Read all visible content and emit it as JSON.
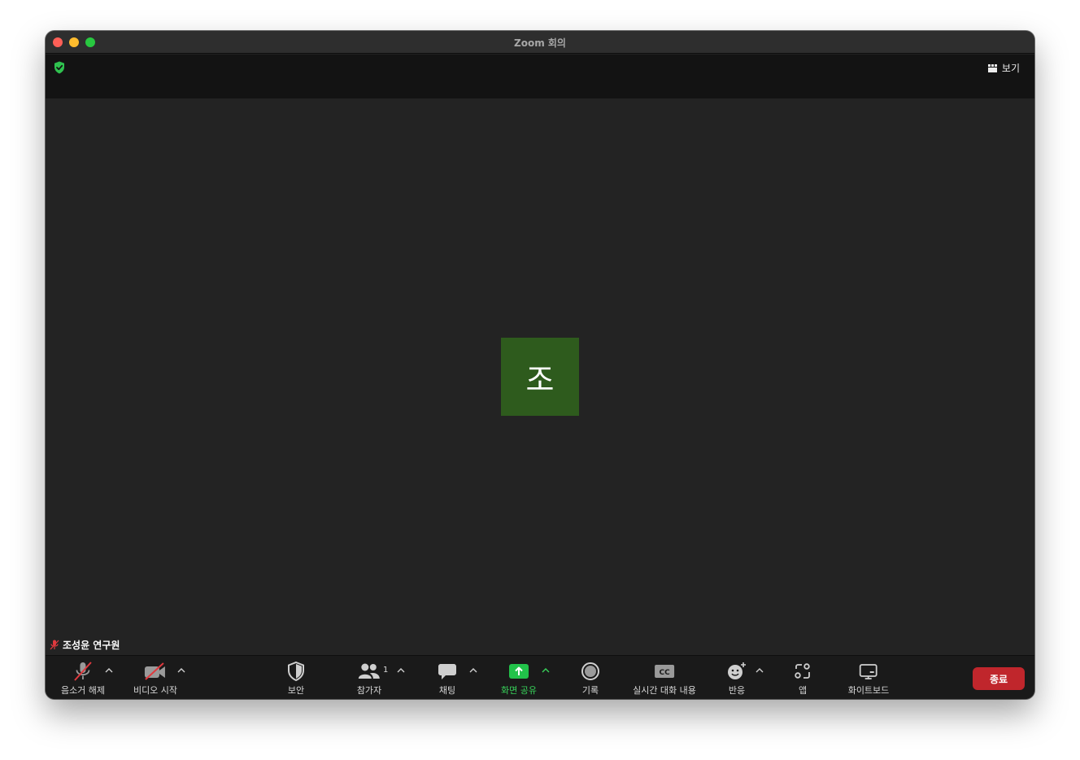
{
  "window": {
    "title": "Zoom 회의",
    "controls": [
      "close",
      "minimize",
      "maximize"
    ]
  },
  "topbar": {
    "security_icon": "shield-check-icon",
    "view_label": "보기"
  },
  "participant": {
    "initial": "조",
    "name": "조성윤 연구원",
    "avatar_color": "#2e5b1d",
    "muted": true
  },
  "toolbar": {
    "unmute_label": "음소거 해제",
    "start_video_label": "비디오 시작",
    "security_label": "보안",
    "participants_label": "참가자",
    "participants_count": "1",
    "chat_label": "채팅",
    "share_label": "화면 공유",
    "record_label": "기록",
    "captions_label": "실시간 대화 내용",
    "captions_badge": "CC",
    "reactions_label": "반응",
    "apps_label": "앱",
    "whiteboard_label": "화이트보드",
    "end_label": "종료"
  },
  "colors": {
    "accent_green": "#38d35a",
    "end_red": "#c0262c",
    "muted_red": "#e0393e"
  }
}
